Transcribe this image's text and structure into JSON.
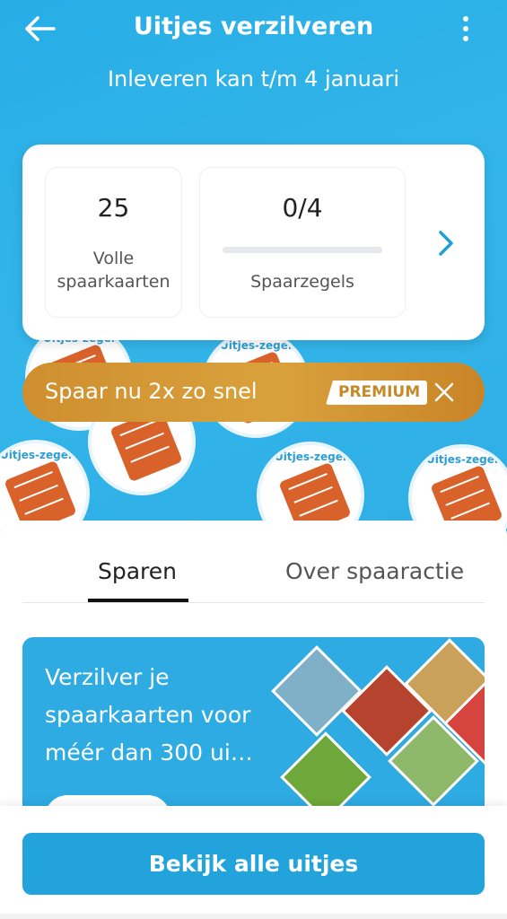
{
  "header": {
    "title": "Uitjes verzilveren",
    "back_icon": "arrow-left-icon",
    "menu_icon": "more-vertical-icon"
  },
  "subtitle": "Inleveren kan t/m 4 januari",
  "stats": {
    "full_cards_value": "25",
    "full_cards_label": "Volle spaarkaarten",
    "stamps_value": "0/4",
    "stamps_progress": 0,
    "stamps_label": "Spaarzegels",
    "chevron_icon": "chevron-right-icon"
  },
  "stamp_text": "Uitjes-zegel",
  "promo": {
    "text": "Spaar nu 2x zo snel",
    "badge": "PREMIUM",
    "close_icon": "close-icon"
  },
  "tabs": [
    {
      "label": "Sparen",
      "active": true
    },
    {
      "label": "Over spaaractie",
      "active": false
    }
  ],
  "banner": {
    "title": "Verzilver je spaarkaarten voor méér dan 300 ui…"
  },
  "cta": {
    "label": "Bekijk alle uitjes"
  },
  "colors": {
    "brand_blue": "#27aee6",
    "button_blue": "#22a3dc",
    "promo_gold": "#d9a13c"
  }
}
